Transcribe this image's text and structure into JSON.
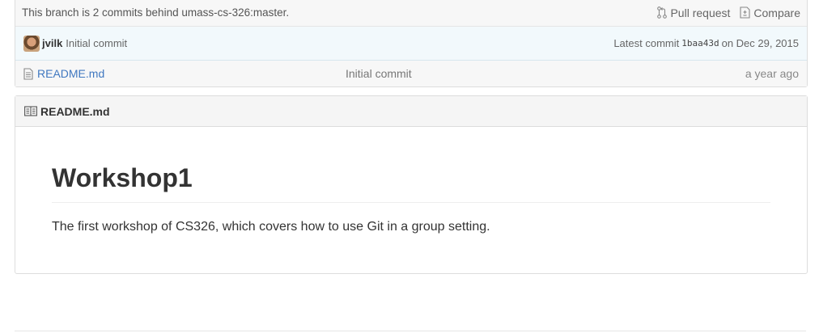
{
  "branch_bar": {
    "status": "This branch is 2 commits behind umass-cs-326:master.",
    "pull_request_label": "Pull request",
    "compare_label": "Compare"
  },
  "commit_bar": {
    "author": "jvilk",
    "message": "Initial commit",
    "latest_prefix": "Latest commit",
    "sha": "1baa43d",
    "date": "on Dec 29, 2015"
  },
  "files": [
    {
      "name": "README.md",
      "message": "Initial commit",
      "age": "a year ago"
    }
  ],
  "readme": {
    "filename": "README.md",
    "heading": "Workshop1",
    "paragraph": "The first workshop of CS326, which covers how to use Git in a group setting."
  },
  "colors": {
    "link": "#4078c0",
    "commit_bar_bg": "#f2f9fc"
  }
}
